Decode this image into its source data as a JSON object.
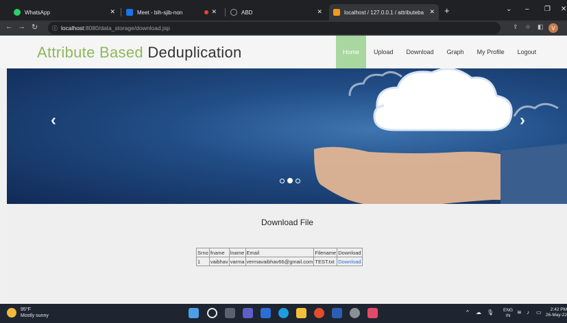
{
  "browser": {
    "tabs": [
      {
        "title": "WhatsApp",
        "icon": "whatsapp-icon",
        "color": "#25d366"
      },
      {
        "title": "Meet - bih-sjib-non",
        "icon": "meet-icon",
        "color": "#1a73e8"
      },
      {
        "title": "ABD",
        "icon": "globe-icon",
        "color": "#9aa0a6"
      },
      {
        "title": "localhost / 127.0.0.1 / attributeba",
        "icon": "phpmyadmin-icon",
        "color": "#f29b1d"
      }
    ],
    "recording_dot_color": "#ea4335",
    "url_host": "localhost",
    "url_rest": ":8080/data_storage/download.jsp",
    "profile_initial": "V"
  },
  "site": {
    "brand_colored": "Attribute Based",
    "brand_plain": "Deduplication",
    "brand_accent_color": "#8fb85a",
    "menu": [
      "Home",
      "Upload",
      "Download",
      "Graph",
      "My Profile",
      "Logout"
    ],
    "active_menu": "Home"
  },
  "hero": {
    "prev_arrow": "‹",
    "next_arrow": "›",
    "slide_count": 3,
    "active_slide": 2
  },
  "download": {
    "title": "Download File",
    "columns": [
      "Srno",
      "fname",
      "lname",
      "Email",
      "Filename",
      "Download"
    ],
    "rows": [
      [
        "1",
        "vaibhav",
        "varma",
        "vermavaibhav66@gmail.com",
        "TEST.txt",
        "Download"
      ]
    ]
  },
  "taskbar": {
    "temperature": "95°F",
    "weather": "Mostly sunny",
    "lang": "ENG",
    "region": "IN",
    "time": "2:42 PM",
    "date": "26-May-22"
  }
}
